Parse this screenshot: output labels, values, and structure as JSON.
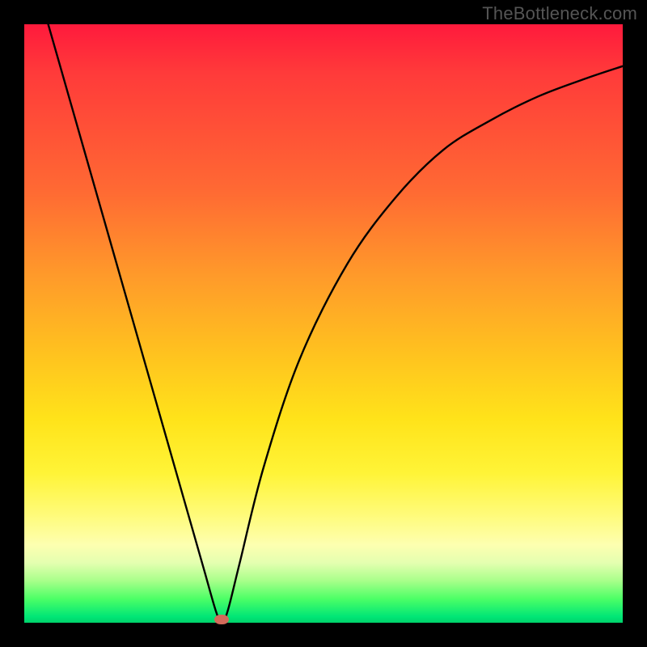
{
  "watermark": "TheBottleneck.com",
  "colors": {
    "frame": "#000000",
    "curve_stroke": "#000000",
    "marker_fill": "#d36a5a",
    "gradient_top": "#ff1a3c",
    "gradient_bottom": "#00d26a"
  },
  "chart_data": {
    "type": "line",
    "title": "",
    "xlabel": "",
    "ylabel": "",
    "xlim": [
      0,
      100
    ],
    "ylim": [
      0,
      100
    ],
    "grid": false,
    "legend": false,
    "series": [
      {
        "name": "bottleneck-curve",
        "x": [
          4,
          8,
          12,
          16,
          20,
          24,
          28,
          30,
          32,
          33,
          34,
          36,
          40,
          46,
          54,
          62,
          70,
          78,
          86,
          94,
          100
        ],
        "y": [
          100,
          86,
          72,
          58,
          44,
          30,
          16,
          9,
          2,
          0,
          2,
          10,
          26,
          44,
          60,
          71,
          79,
          84,
          88,
          91,
          93
        ]
      }
    ],
    "annotations": [
      {
        "name": "minimum-marker",
        "x": 33,
        "y": 0
      }
    ],
    "notes": "Y-axis is inverted visually (0 at bottom = green/good, 100 at top = red/bad). Values estimated from gradient position and curve shape."
  }
}
